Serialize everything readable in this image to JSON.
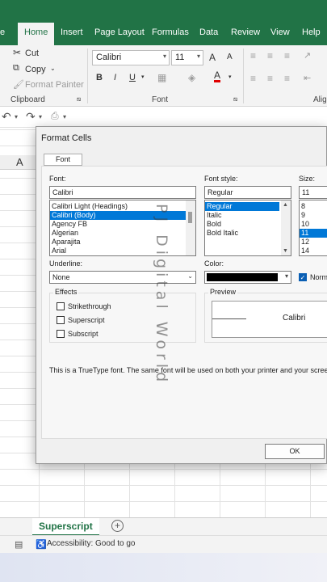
{
  "ribbon_tabs": [
    "e",
    "Home",
    "Insert",
    "Page Layout",
    "Formulas",
    "Data",
    "Review",
    "View",
    "Help"
  ],
  "clipboard": {
    "cut": "Cut",
    "copy": "Copy",
    "format_painter": "Format Painter",
    "group_label": "Clipboard"
  },
  "font_group": {
    "font_name": "Calibri",
    "font_size": "11",
    "bold": "B",
    "italic": "I",
    "underline": "U",
    "grow": "A",
    "shrink": "A",
    "group_label": "Font"
  },
  "align_group_label": "Alig",
  "column_header": "A",
  "dialog": {
    "title": "Format Cells",
    "tab": "Font",
    "font_label": "Font:",
    "font_value": "Calibri",
    "fonts": [
      "Calibri Light (Headings)",
      "Calibri (Body)",
      "Agency FB",
      "Algerian",
      "Aparajita",
      "Arial"
    ],
    "font_selected": "Calibri (Body)",
    "style_label": "Font style:",
    "style_value": "Regular",
    "styles": [
      "Regular",
      "Italic",
      "Bold",
      "Bold Italic"
    ],
    "style_selected": "Regular",
    "size_label": "Size:",
    "size_value": "11",
    "sizes": [
      "8",
      "9",
      "10",
      "11",
      "12",
      "14"
    ],
    "size_selected": "11",
    "underline_label": "Underline:",
    "underline_value": "None",
    "color_label": "Color:",
    "color_value": "#000000",
    "normal_font_label": "Norm",
    "effects_label": "Effects",
    "strikethrough": "Strikethrough",
    "superscript": "Superscript",
    "subscript": "Subscript",
    "preview_label": "Preview",
    "preview_text": "Calibri",
    "info_text": "This is a TrueType font.  The same font will be used on both your printer and your screen",
    "ok": "OK"
  },
  "watermark": "PJ Digital World",
  "sheet_tab": "Superscript",
  "add_sheet": "+",
  "status_text": "Accessibility: Good to go",
  "colors": {
    "excel_green": "#217346",
    "selection_blue": "#0078d7"
  }
}
